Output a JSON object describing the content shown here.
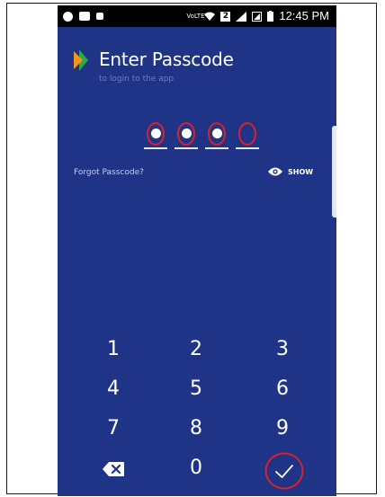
{
  "status_bar": {
    "network_label": "VoLTE",
    "sim_badge": "2",
    "time": "12:45 PM"
  },
  "header": {
    "title": "Enter Passcode",
    "subtitle": "to login to the app"
  },
  "passcode": {
    "digits_entered": 3,
    "length": 4
  },
  "actions": {
    "forgot_label": "Forgot Passcode?",
    "show_label": "SHOW"
  },
  "keypad": {
    "k1": "1",
    "k2": "2",
    "k3": "3",
    "k4": "4",
    "k5": "5",
    "k6": "6",
    "k7": "7",
    "k8": "8",
    "k9": "9",
    "k0": "0"
  },
  "icons": {
    "logo": "bhim-flag-icon",
    "eye": "eye-icon",
    "backspace": "backspace-icon",
    "confirm": "checkmark-icon"
  },
  "colors": {
    "background": "#1f3486",
    "highlight_ring": "#d8222a",
    "logo_orange": "#f7941d",
    "logo_green": "#2aa84a"
  }
}
